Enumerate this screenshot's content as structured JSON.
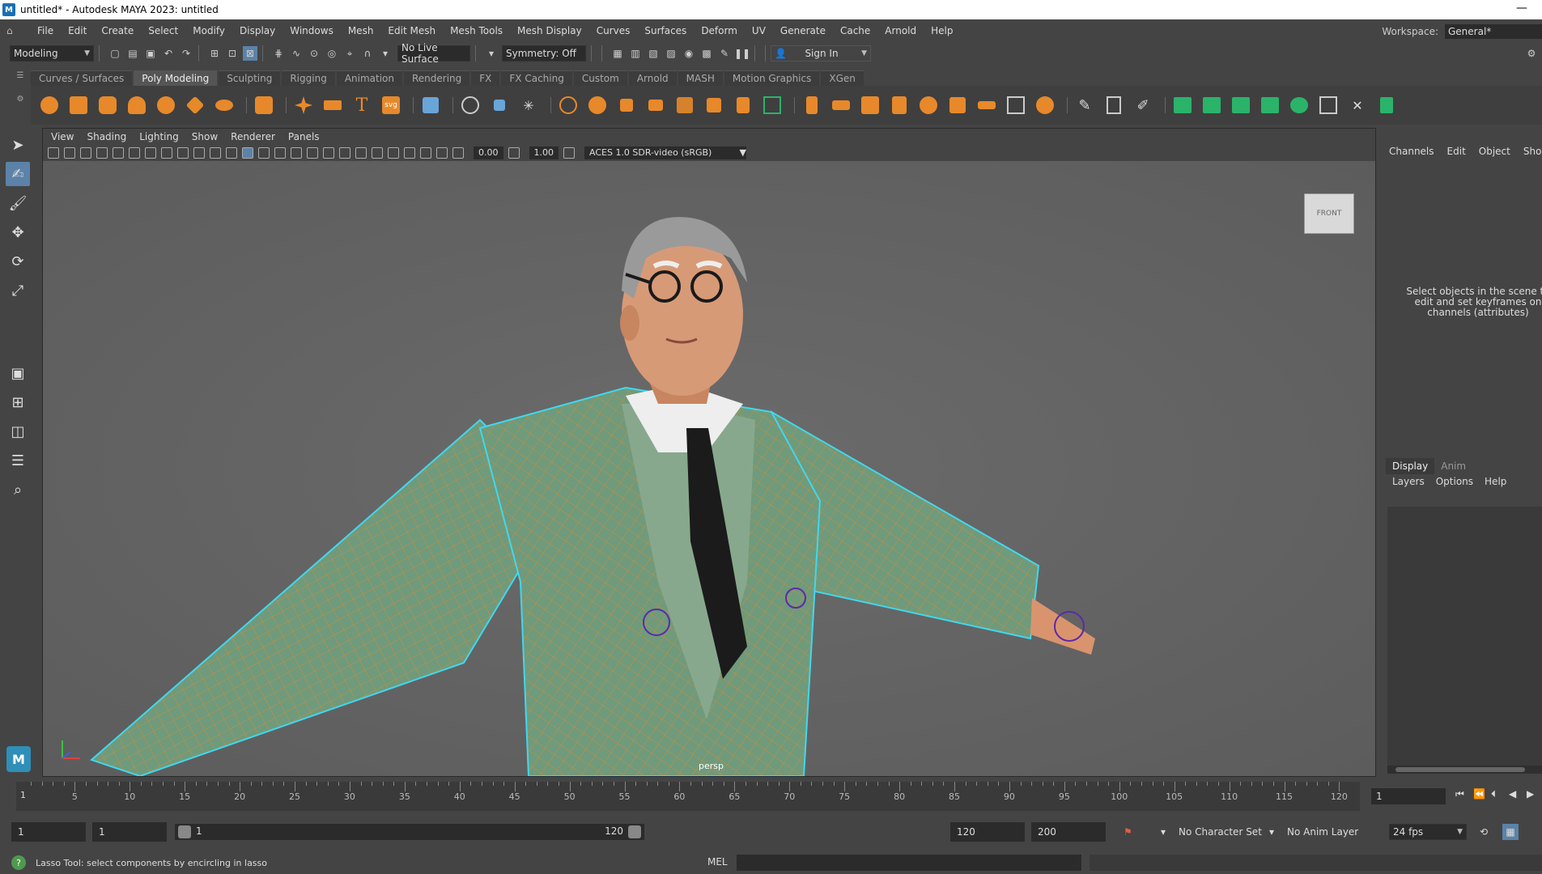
{
  "window": {
    "title": "untitled* - Autodesk MAYA 2023: untitled",
    "logo": "M"
  },
  "menu": [
    "File",
    "Edit",
    "Create",
    "Select",
    "Modify",
    "Display",
    "Windows",
    "Mesh",
    "Edit Mesh",
    "Mesh Tools",
    "Mesh Display",
    "Curves",
    "Surfaces",
    "Deform",
    "UV",
    "Generate",
    "Cache",
    "Arnold",
    "Help"
  ],
  "workspace": {
    "label": "Workspace:",
    "value": "General*"
  },
  "statusline": {
    "mode": "Modeling",
    "live_surface": "No Live Surface",
    "symmetry": "Symmetry: Off",
    "sign_in": "Sign In"
  },
  "shelf_tabs": [
    "Curves / Surfaces",
    "Poly Modeling",
    "Sculpting",
    "Rigging",
    "Animation",
    "Rendering",
    "FX",
    "FX Caching",
    "Custom",
    "Arnold",
    "MASH",
    "Motion Graphics",
    "XGen"
  ],
  "active_shelf_tab": "Poly Modeling",
  "viewport": {
    "menu": [
      "View",
      "Shading",
      "Lighting",
      "Show",
      "Renderer",
      "Panels"
    ],
    "exposure": "0.00",
    "gamma": "1.00",
    "color_space": "ACES 1.0 SDR-video (sRGB)",
    "camera": "persp",
    "viewcube_label": "FRONT"
  },
  "channel_box": {
    "menu": [
      "Channels",
      "Edit",
      "Object",
      "Show"
    ],
    "empty_message": "Select objects in the scene to edit and set keyframes on channels (attributes)"
  },
  "layer_editor": {
    "tabs": [
      "Display",
      "Anim"
    ],
    "menu": [
      "Layers",
      "Options",
      "Help"
    ]
  },
  "timeslider": {
    "ticks": [
      "5",
      "10",
      "15",
      "20",
      "25",
      "30",
      "35",
      "40",
      "45",
      "50",
      "55",
      "60",
      "65",
      "70",
      "75",
      "80",
      "85",
      "90",
      "95",
      "100",
      "105",
      "110",
      "115",
      "120"
    ],
    "current_frame": "1",
    "frame_field": "1"
  },
  "range": {
    "start": "1",
    "playback_start": "1",
    "slider_start": "1",
    "slider_end": "120",
    "playback_end": "120",
    "end": "200",
    "character_set": "No Character Set",
    "anim_layer": "No Anim Layer",
    "fps": "24 fps"
  },
  "helpline": {
    "text": "Lasso Tool: select components by encircling in lasso",
    "command_lang": "MEL"
  },
  "colors": {
    "accent": "#5c82a8",
    "shelf_orange": "#e7892a",
    "shelf_green": "#2bb36a",
    "wire_cyan": "#3fd8f0",
    "wire_orange": "#e08a2a"
  }
}
